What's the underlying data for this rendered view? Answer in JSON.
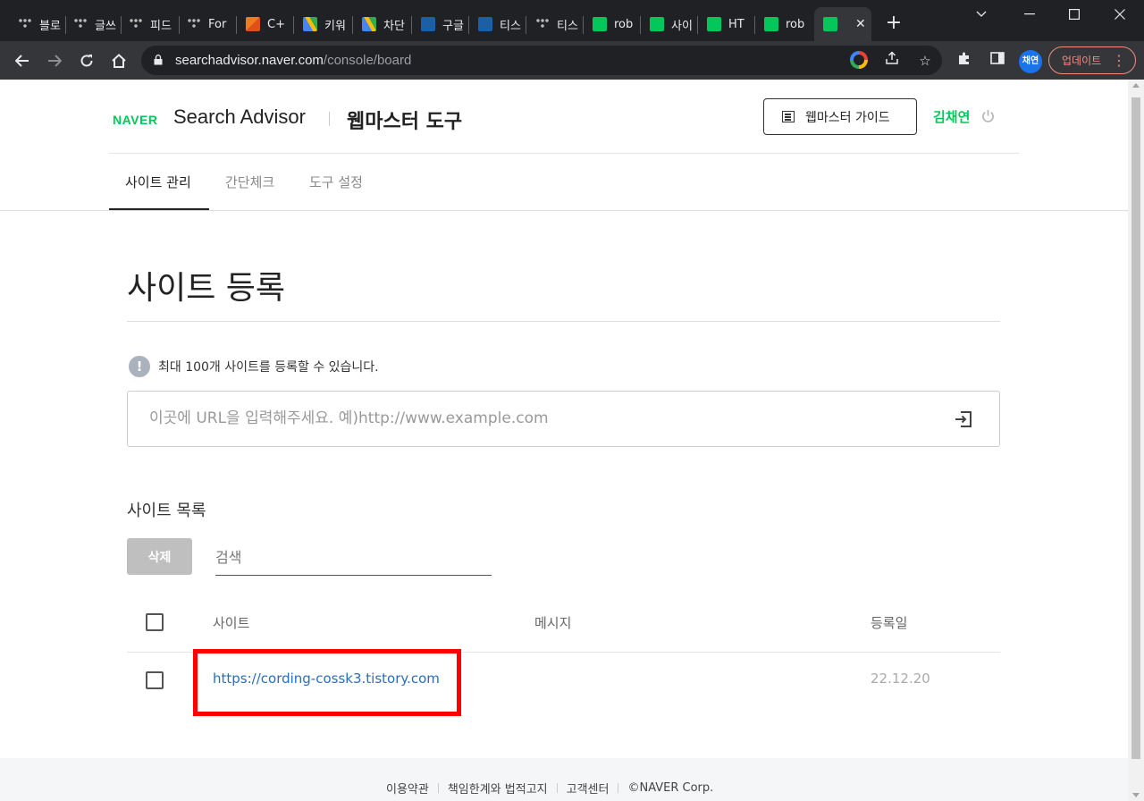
{
  "browser": {
    "tabs": [
      {
        "label": "블로",
        "icon": "dots-icon"
      },
      {
        "label": "글쓰",
        "icon": "dots-icon"
      },
      {
        "label": "피드",
        "icon": "dots-icon"
      },
      {
        "label": "For",
        "icon": "dots-icon"
      },
      {
        "label": "C+",
        "icon": "orange-icon"
      },
      {
        "label": "키워",
        "icon": "google-ads-icon"
      },
      {
        "label": "차단",
        "icon": "google-ads-icon"
      },
      {
        "label": "구글",
        "icon": "c-site-icon"
      },
      {
        "label": "티스",
        "icon": "c-site-icon"
      },
      {
        "label": "티스",
        "icon": "dots-icon"
      },
      {
        "label": "rob",
        "icon": "naver-sa-icon"
      },
      {
        "label": "사이",
        "icon": "naver-sa-icon"
      },
      {
        "label": "HT",
        "icon": "naver-sa-icon"
      },
      {
        "label": "rob",
        "icon": "naver-sa-icon"
      },
      {
        "label": "",
        "icon": "naver-sa-icon",
        "active": true
      }
    ],
    "active_tab_close": "✕",
    "new_tab": "+",
    "url_host": "searchadvisor.naver.com",
    "url_path": "/console/board",
    "profile_label": "채연",
    "update_label": "업데이트",
    "update_menu": "⋮"
  },
  "header": {
    "naver_logo": "NAVER",
    "brand": "Search Advisor",
    "tool_name": "웹마스터 도구",
    "guide_button": "웹마스터 가이드",
    "user_name": "김채연"
  },
  "nav": {
    "tabs": [
      {
        "label": "사이트 관리",
        "active": true
      },
      {
        "label": "간단체크",
        "active": false
      },
      {
        "label": "도구 설정",
        "active": false
      }
    ]
  },
  "main": {
    "title": "사이트 등록",
    "info_icon_char": "!",
    "info_text": "최대 100개 사이트를 등록할 수 있습니다.",
    "url_placeholder": "이곳에 URL을 입력해주세요. 예)http://www.example.com",
    "url_value": ""
  },
  "site_list": {
    "title": "사이트 목록",
    "delete_button": "삭제",
    "search_placeholder": "검색",
    "columns": {
      "site": "사이트",
      "message": "메시지",
      "date": "등록일"
    },
    "rows": [
      {
        "site": "https://cording-cossk3.tistory.com",
        "message": "",
        "date": "22.12.20",
        "checked": false
      }
    ]
  },
  "footer": {
    "links": [
      "이용약관",
      "책임한계와 법적고지",
      "고객센터",
      "©NAVER Corp."
    ]
  },
  "colors": {
    "naver_green": "#03c75a",
    "link_blue": "#2a6ebb",
    "highlight_red": "#ff0000"
  }
}
